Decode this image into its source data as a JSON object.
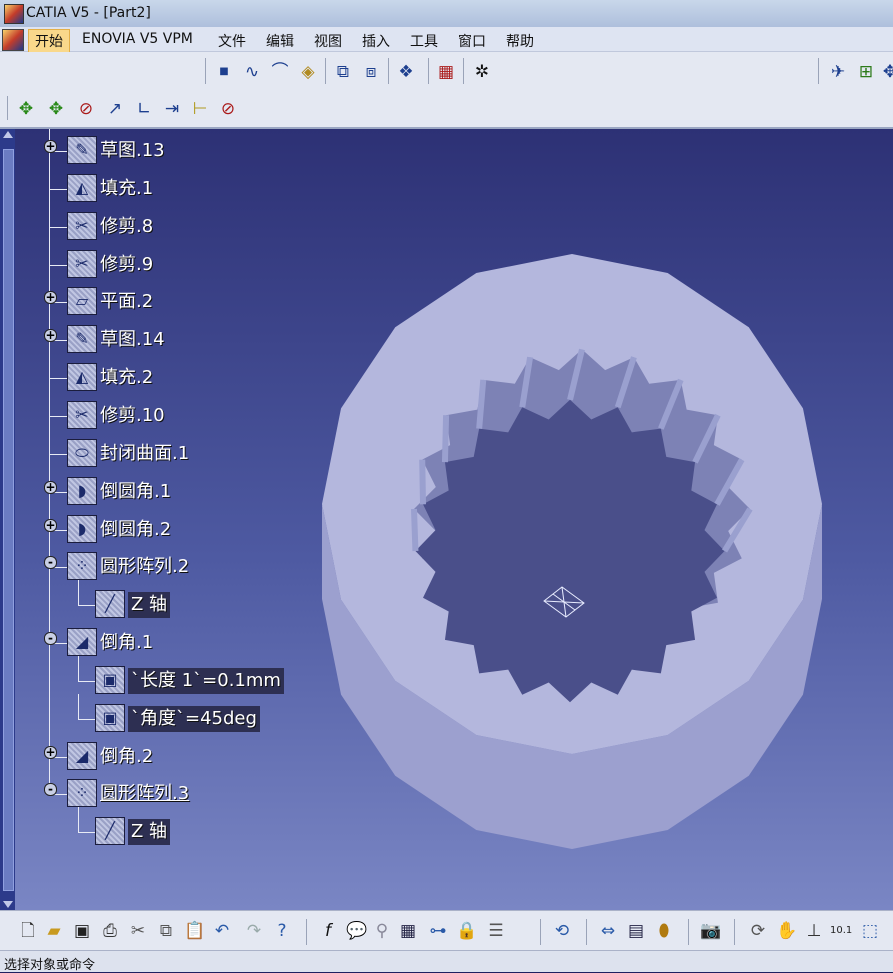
{
  "window": {
    "title": "CATIA V5 - [Part2]"
  },
  "menu": [
    {
      "label": "开始",
      "active": true
    },
    {
      "label": "ENOVIA V5 VPM",
      "active": false
    },
    {
      "label": "文件",
      "active": false
    },
    {
      "label": "编辑",
      "active": false
    },
    {
      "label": "视图",
      "active": false
    },
    {
      "label": "插入",
      "active": false
    },
    {
      "label": "工具",
      "active": false
    },
    {
      "label": "窗口",
      "active": false
    },
    {
      "label": "帮助",
      "active": false
    }
  ],
  "tree": [
    {
      "label": "草图.13",
      "expander": "+",
      "icon": "sketch-icon"
    },
    {
      "label": "填充.1",
      "expander": "",
      "icon": "fill-surface-icon"
    },
    {
      "label": "修剪.8",
      "expander": "",
      "icon": "trim-icon"
    },
    {
      "label": "修剪.9",
      "expander": "",
      "icon": "trim-icon"
    },
    {
      "label": "平面.2",
      "expander": "+",
      "icon": "plane-icon"
    },
    {
      "label": "草图.14",
      "expander": "+",
      "icon": "sketch-icon"
    },
    {
      "label": "填充.2",
      "expander": "",
      "icon": "fill-surface-icon"
    },
    {
      "label": "修剪.10",
      "expander": "",
      "icon": "trim-icon"
    },
    {
      "label": "封闭曲面.1",
      "expander": "",
      "icon": "close-surface-icon"
    },
    {
      "label": "倒圆角.1",
      "expander": "+",
      "icon": "edge-fillet-icon"
    },
    {
      "label": "倒圆角.2",
      "expander": "+",
      "icon": "edge-fillet-icon"
    },
    {
      "label": "圆形阵列.2",
      "expander": "-",
      "icon": "circular-pattern-icon"
    },
    {
      "label": "Z 轴",
      "expander": "",
      "icon": "axis-icon",
      "child": true,
      "boxed": true
    },
    {
      "label": "倒角.1",
      "expander": "-",
      "icon": "chamfer-icon"
    },
    {
      "label": "`长度 1`=0.1mm",
      "expander": "",
      "icon": "parameter-icon",
      "child": true,
      "boxed": true
    },
    {
      "label": "`角度`=45deg",
      "expander": "",
      "icon": "parameter-icon",
      "child": true,
      "boxed": true
    },
    {
      "label": "倒角.2",
      "expander": "+",
      "icon": "chamfer-icon"
    },
    {
      "label": "圆形阵列.3",
      "expander": "-",
      "icon": "circular-pattern-icon",
      "underlined": true
    },
    {
      "label": "Z 轴",
      "expander": "",
      "icon": "axis-icon",
      "child": true,
      "boxed": true
    }
  ],
  "status": {
    "text": "选择对象或命令"
  },
  "model": {
    "teeth": 20
  },
  "colors": {
    "part_fill": "#b4b7dd",
    "part_shadow": "#8e93c2",
    "background_top": "#2d3175"
  }
}
